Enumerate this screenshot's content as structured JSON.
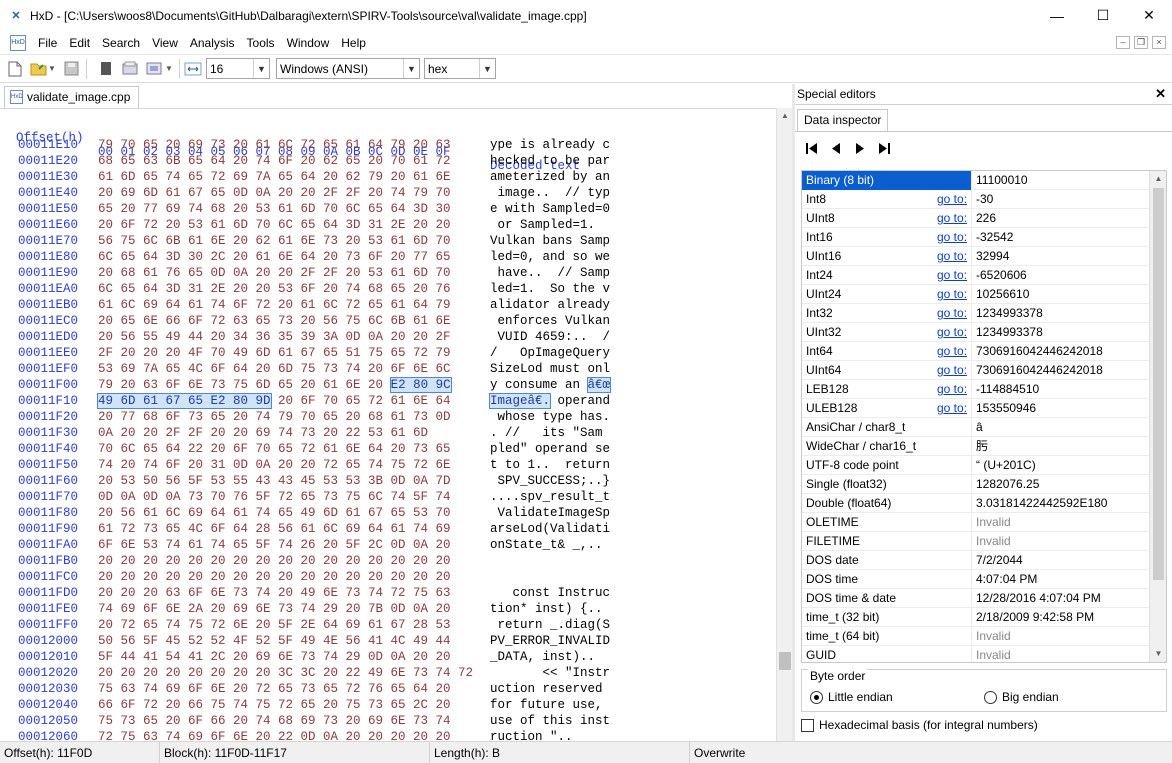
{
  "window": {
    "title": "HxD - [C:\\Users\\woos8\\Documents\\GitHub\\Dalbaragi\\extern\\SPIRV-Tools\\source\\val\\validate_image.cpp]",
    "minimize": "—",
    "maximize": "☐",
    "close": "✕"
  },
  "menu": {
    "items": [
      "File",
      "Edit",
      "Search",
      "View",
      "Analysis",
      "Tools",
      "Window",
      "Help"
    ]
  },
  "toolbar": {
    "bytes_per_row": "16",
    "charset": "Windows (ANSI)",
    "offset_base": "hex"
  },
  "document_tab": {
    "label": "validate_image.cpp"
  },
  "hex": {
    "header_offset": "Offset(h)",
    "header_columns": "00 01 02 03 04 05 06 07 08 09 0A 0B 0C 0D 0E 0F",
    "header_text": "Decoded text",
    "rows": [
      {
        "off": "00011E10",
        "hex": "79 70 65 20 69 73 20 61 6C 72 65 61 64 79 20 63",
        "txt": "ype is already c"
      },
      {
        "off": "00011E20",
        "hex": "68 65 63 6B 65 64 20 74 6F 20 62 65 20 70 61 72",
        "txt": "hecked to be par"
      },
      {
        "off": "00011E30",
        "hex": "61 6D 65 74 65 72 69 7A 65 64 20 62 79 20 61 6E",
        "txt": "ameterized by an"
      },
      {
        "off": "00011E40",
        "hex": "20 69 6D 61 67 65 0D 0A 20 20 2F 2F 20 74 79 70",
        "txt": " image..  // typ"
      },
      {
        "off": "00011E50",
        "hex": "65 20 77 69 74 68 20 53 61 6D 70 6C 65 64 3D 30",
        "txt": "e with Sampled=0"
      },
      {
        "off": "00011E60",
        "hex": "20 6F 72 20 53 61 6D 70 6C 65 64 3D 31 2E 20 20",
        "txt": " or Sampled=1.  "
      },
      {
        "off": "00011E70",
        "hex": "56 75 6C 6B 61 6E 20 62 61 6E 73 20 53 61 6D 70",
        "txt": "Vulkan bans Samp"
      },
      {
        "off": "00011E80",
        "hex": "6C 65 64 3D 30 2C 20 61 6E 64 20 73 6F 20 77 65",
        "txt": "led=0, and so we"
      },
      {
        "off": "00011E90",
        "hex": "20 68 61 76 65 0D 0A 20 20 2F 2F 20 53 61 6D 70",
        "txt": " have..  // Samp"
      },
      {
        "off": "00011EA0",
        "hex": "6C 65 64 3D 31 2E 20 20 53 6F 20 74 68 65 20 76",
        "txt": "led=1.  So the v"
      },
      {
        "off": "00011EB0",
        "hex": "61 6C 69 64 61 74 6F 72 20 61 6C 72 65 61 64 79",
        "txt": "alidator already"
      },
      {
        "off": "00011EC0",
        "hex": "20 65 6E 66 6F 72 63 65 73 20 56 75 6C 6B 61 6E",
        "txt": " enforces Vulkan"
      },
      {
        "off": "00011ED0",
        "hex": "20 56 55 49 44 20 34 36 35 39 3A 0D 0A 20 20 2F",
        "txt": " VUID 4659:..  /"
      },
      {
        "off": "00011EE0",
        "hex": "2F 20 20 20 4F 70 49 6D 61 67 65 51 75 65 72 79",
        "txt": "/   OpImageQuery"
      },
      {
        "off": "00011EF0",
        "hex": "53 69 7A 65 4C 6F 64 20 6D 75 73 74 20 6F 6E 6C",
        "txt": "SizeLod must onl"
      },
      {
        "off": "00011F00",
        "hex": "79 20 63 6F 6E 73 75 6D 65 20 61 6E 20 ",
        "hexsel": "E2 80 9C",
        "txt": "y consume an ",
        "txtsel": "â€œ"
      },
      {
        "off": "00011F10",
        "hexsel": "49 6D 61 67 65 E2 80 9D",
        "hex": " 20 6F 70 65 72 61 6E 64",
        "txtsel": "Imageâ€.",
        "txt": " operand",
        "selfirst": true
      },
      {
        "off": "00011F20",
        "hex": "20 77 68 6F 73 65 20 74 79 70 65 20 68 61 73 0D",
        "txt": " whose type has."
      },
      {
        "off": "00011F30",
        "hex": "0A 20 20 2F 2F 20 20 69 74 73 20 22 53 61 6D",
        "txt": ". //   its \"Sam"
      },
      {
        "off": "00011F40",
        "hex": "70 6C 65 64 22 20 6F 70 65 72 61 6E 64 20 73 65",
        "txt": "pled\" operand se"
      },
      {
        "off": "00011F50",
        "hex": "74 20 74 6F 20 31 0D 0A 20 20 72 65 74 75 72 6E",
        "txt": "t to 1..  return"
      },
      {
        "off": "00011F60",
        "hex": "20 53 50 56 5F 53 55 43 43 45 53 53 3B 0D 0A 7D",
        "txt": " SPV_SUCCESS;..}"
      },
      {
        "off": "00011F70",
        "hex": "0D 0A 0D 0A 73 70 76 5F 72 65 73 75 6C 74 5F 74",
        "txt": "....spv_result_t"
      },
      {
        "off": "00011F80",
        "hex": "20 56 61 6C 69 64 61 74 65 49 6D 61 67 65 53 70",
        "txt": " ValidateImageSp"
      },
      {
        "off": "00011F90",
        "hex": "61 72 73 65 4C 6F 64 28 56 61 6C 69 64 61 74 69",
        "txt": "arseLod(Validati"
      },
      {
        "off": "00011FA0",
        "hex": "6F 6E 53 74 61 74 65 5F 74 26 20 5F 2C 0D 0A 20",
        "txt": "onState_t& _,.. "
      },
      {
        "off": "00011FB0",
        "hex": "20 20 20 20 20 20 20 20 20 20 20 20 20 20 20 20",
        "txt": "                "
      },
      {
        "off": "00011FC0",
        "hex": "20 20 20 20 20 20 20 20 20 20 20 20 20 20 20 20",
        "txt": "                "
      },
      {
        "off": "00011FD0",
        "hex": "20 20 20 63 6F 6E 73 74 20 49 6E 73 74 72 75 63",
        "txt": "   const Instruc"
      },
      {
        "off": "00011FE0",
        "hex": "74 69 6F 6E 2A 20 69 6E 73 74 29 20 7B 0D 0A 20",
        "txt": "tion* inst) {.. "
      },
      {
        "off": "00011FF0",
        "hex": "20 72 65 74 75 72 6E 20 5F 2E 64 69 61 67 28 53",
        "txt": " return _.diag(S"
      },
      {
        "off": "00012000",
        "hex": "50 56 5F 45 52 52 4F 52 5F 49 4E 56 41 4C 49 44",
        "txt": "PV_ERROR_INVALID"
      },
      {
        "off": "00012010",
        "hex": "5F 44 41 54 41 2C 20 69 6E 73 74 29 0D 0A 20 20",
        "txt": "_DATA, inst)..  "
      },
      {
        "off": "00012020",
        "hex": "20 20 20 20 20 20 20 20 3C 3C 20 22 49 6E 73 74 72",
        "txt": "       << \"Instr"
      },
      {
        "off": "00012030",
        "hex": "75 63 74 69 6F 6E 20 72 65 73 65 72 76 65 64 20",
        "txt": "uction reserved "
      },
      {
        "off": "00012040",
        "hex": "66 6F 72 20 66 75 74 75 72 65 20 75 73 65 2C 20",
        "txt": "for future use, "
      },
      {
        "off": "00012050",
        "hex": "75 73 65 20 6F 66 20 74 68 69 73 20 69 6E 73 74",
        "txt": "use of this inst"
      },
      {
        "off": "00012060",
        "hex": "72 75 63 74 69 6F 6E 20 22 0D 0A 20 20 20 20 20",
        "txt": "ruction \".."
      }
    ]
  },
  "special_editors": {
    "title": "Special editors",
    "tab": "Data inspector",
    "goto_label": "go to:",
    "rows": [
      {
        "name": "Binary (8 bit)",
        "value": "11100010",
        "goto": false,
        "selected": true
      },
      {
        "name": "Int8",
        "value": "-30",
        "goto": true
      },
      {
        "name": "UInt8",
        "value": "226",
        "goto": true
      },
      {
        "name": "Int16",
        "value": "-32542",
        "goto": true
      },
      {
        "name": "UInt16",
        "value": "32994",
        "goto": true
      },
      {
        "name": "Int24",
        "value": "-6520606",
        "goto": true
      },
      {
        "name": "UInt24",
        "value": "10256610",
        "goto": true
      },
      {
        "name": "Int32",
        "value": "1234993378",
        "goto": true
      },
      {
        "name": "UInt32",
        "value": "1234993378",
        "goto": true
      },
      {
        "name": "Int64",
        "value": "7306916042446242018",
        "goto": true
      },
      {
        "name": "UInt64",
        "value": "7306916042446242018",
        "goto": true
      },
      {
        "name": "LEB128",
        "value": "-114884510",
        "goto": true
      },
      {
        "name": "ULEB128",
        "value": "153550946",
        "goto": true
      },
      {
        "name": "AnsiChar / char8_t",
        "value": "â",
        "goto": false
      },
      {
        "name": "WideChar / char16_t",
        "value": "肟",
        "goto": false
      },
      {
        "name": "UTF-8 code point",
        "value": "“ (U+201C)",
        "goto": false
      },
      {
        "name": "Single (float32)",
        "value": "1282076.25",
        "goto": false
      },
      {
        "name": "Double (float64)",
        "value": "3.03181422442592E180",
        "goto": false
      },
      {
        "name": "OLETIME",
        "value": "Invalid",
        "goto": false,
        "invalid": true
      },
      {
        "name": "FILETIME",
        "value": "Invalid",
        "goto": false,
        "invalid": true
      },
      {
        "name": "DOS date",
        "value": "7/2/2044",
        "goto": false
      },
      {
        "name": "DOS time",
        "value": "4:07:04 PM",
        "goto": false
      },
      {
        "name": "DOS time & date",
        "value": "12/28/2016 4:07:04 PM",
        "goto": false
      },
      {
        "name": "time_t (32 bit)",
        "value": "2/18/2009 9:42:58 PM",
        "goto": false
      },
      {
        "name": "time_t (64 bit)",
        "value": "Invalid",
        "goto": false,
        "invalid": true
      },
      {
        "name": "GUID",
        "value": "Invalid",
        "goto": false,
        "invalid": true
      }
    ],
    "byte_order_label": "Byte order",
    "little_endian": "Little endian",
    "big_endian": "Big endian",
    "hex_basis": "Hexadecimal basis (for integral numbers)"
  },
  "status": {
    "offset": "Offset(h): 11F0D",
    "block": "Block(h): 11F0D-11F17",
    "length": "Length(h): B",
    "mode": "Overwrite"
  }
}
